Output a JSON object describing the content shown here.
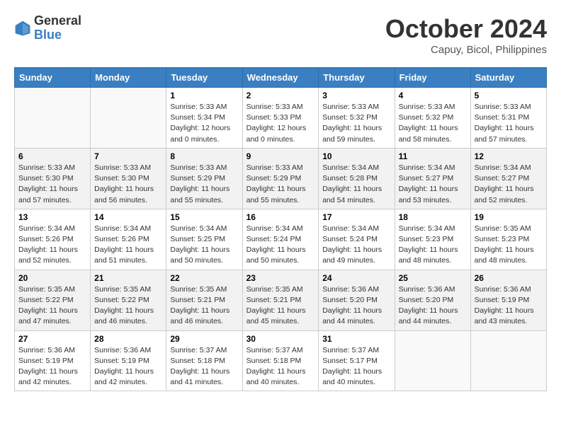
{
  "header": {
    "logo_line1": "General",
    "logo_line2": "Blue",
    "month": "October 2024",
    "location": "Capuy, Bicol, Philippines"
  },
  "days_of_week": [
    "Sunday",
    "Monday",
    "Tuesday",
    "Wednesday",
    "Thursday",
    "Friday",
    "Saturday"
  ],
  "weeks": [
    [
      {
        "day": "",
        "sunrise": "",
        "sunset": "",
        "daylight": ""
      },
      {
        "day": "",
        "sunrise": "",
        "sunset": "",
        "daylight": ""
      },
      {
        "day": "1",
        "sunrise": "Sunrise: 5:33 AM",
        "sunset": "Sunset: 5:34 PM",
        "daylight": "Daylight: 12 hours and 0 minutes."
      },
      {
        "day": "2",
        "sunrise": "Sunrise: 5:33 AM",
        "sunset": "Sunset: 5:33 PM",
        "daylight": "Daylight: 12 hours and 0 minutes."
      },
      {
        "day": "3",
        "sunrise": "Sunrise: 5:33 AM",
        "sunset": "Sunset: 5:32 PM",
        "daylight": "Daylight: 11 hours and 59 minutes."
      },
      {
        "day": "4",
        "sunrise": "Sunrise: 5:33 AM",
        "sunset": "Sunset: 5:32 PM",
        "daylight": "Daylight: 11 hours and 58 minutes."
      },
      {
        "day": "5",
        "sunrise": "Sunrise: 5:33 AM",
        "sunset": "Sunset: 5:31 PM",
        "daylight": "Daylight: 11 hours and 57 minutes."
      }
    ],
    [
      {
        "day": "6",
        "sunrise": "Sunrise: 5:33 AM",
        "sunset": "Sunset: 5:30 PM",
        "daylight": "Daylight: 11 hours and 57 minutes."
      },
      {
        "day": "7",
        "sunrise": "Sunrise: 5:33 AM",
        "sunset": "Sunset: 5:30 PM",
        "daylight": "Daylight: 11 hours and 56 minutes."
      },
      {
        "day": "8",
        "sunrise": "Sunrise: 5:33 AM",
        "sunset": "Sunset: 5:29 PM",
        "daylight": "Daylight: 11 hours and 55 minutes."
      },
      {
        "day": "9",
        "sunrise": "Sunrise: 5:33 AM",
        "sunset": "Sunset: 5:29 PM",
        "daylight": "Daylight: 11 hours and 55 minutes."
      },
      {
        "day": "10",
        "sunrise": "Sunrise: 5:34 AM",
        "sunset": "Sunset: 5:28 PM",
        "daylight": "Daylight: 11 hours and 54 minutes."
      },
      {
        "day": "11",
        "sunrise": "Sunrise: 5:34 AM",
        "sunset": "Sunset: 5:27 PM",
        "daylight": "Daylight: 11 hours and 53 minutes."
      },
      {
        "day": "12",
        "sunrise": "Sunrise: 5:34 AM",
        "sunset": "Sunset: 5:27 PM",
        "daylight": "Daylight: 11 hours and 52 minutes."
      }
    ],
    [
      {
        "day": "13",
        "sunrise": "Sunrise: 5:34 AM",
        "sunset": "Sunset: 5:26 PM",
        "daylight": "Daylight: 11 hours and 52 minutes."
      },
      {
        "day": "14",
        "sunrise": "Sunrise: 5:34 AM",
        "sunset": "Sunset: 5:26 PM",
        "daylight": "Daylight: 11 hours and 51 minutes."
      },
      {
        "day": "15",
        "sunrise": "Sunrise: 5:34 AM",
        "sunset": "Sunset: 5:25 PM",
        "daylight": "Daylight: 11 hours and 50 minutes."
      },
      {
        "day": "16",
        "sunrise": "Sunrise: 5:34 AM",
        "sunset": "Sunset: 5:24 PM",
        "daylight": "Daylight: 11 hours and 50 minutes."
      },
      {
        "day": "17",
        "sunrise": "Sunrise: 5:34 AM",
        "sunset": "Sunset: 5:24 PM",
        "daylight": "Daylight: 11 hours and 49 minutes."
      },
      {
        "day": "18",
        "sunrise": "Sunrise: 5:34 AM",
        "sunset": "Sunset: 5:23 PM",
        "daylight": "Daylight: 11 hours and 48 minutes."
      },
      {
        "day": "19",
        "sunrise": "Sunrise: 5:35 AM",
        "sunset": "Sunset: 5:23 PM",
        "daylight": "Daylight: 11 hours and 48 minutes."
      }
    ],
    [
      {
        "day": "20",
        "sunrise": "Sunrise: 5:35 AM",
        "sunset": "Sunset: 5:22 PM",
        "daylight": "Daylight: 11 hours and 47 minutes."
      },
      {
        "day": "21",
        "sunrise": "Sunrise: 5:35 AM",
        "sunset": "Sunset: 5:22 PM",
        "daylight": "Daylight: 11 hours and 46 minutes."
      },
      {
        "day": "22",
        "sunrise": "Sunrise: 5:35 AM",
        "sunset": "Sunset: 5:21 PM",
        "daylight": "Daylight: 11 hours and 46 minutes."
      },
      {
        "day": "23",
        "sunrise": "Sunrise: 5:35 AM",
        "sunset": "Sunset: 5:21 PM",
        "daylight": "Daylight: 11 hours and 45 minutes."
      },
      {
        "day": "24",
        "sunrise": "Sunrise: 5:36 AM",
        "sunset": "Sunset: 5:20 PM",
        "daylight": "Daylight: 11 hours and 44 minutes."
      },
      {
        "day": "25",
        "sunrise": "Sunrise: 5:36 AM",
        "sunset": "Sunset: 5:20 PM",
        "daylight": "Daylight: 11 hours and 44 minutes."
      },
      {
        "day": "26",
        "sunrise": "Sunrise: 5:36 AM",
        "sunset": "Sunset: 5:19 PM",
        "daylight": "Daylight: 11 hours and 43 minutes."
      }
    ],
    [
      {
        "day": "27",
        "sunrise": "Sunrise: 5:36 AM",
        "sunset": "Sunset: 5:19 PM",
        "daylight": "Daylight: 11 hours and 42 minutes."
      },
      {
        "day": "28",
        "sunrise": "Sunrise: 5:36 AM",
        "sunset": "Sunset: 5:19 PM",
        "daylight": "Daylight: 11 hours and 42 minutes."
      },
      {
        "day": "29",
        "sunrise": "Sunrise: 5:37 AM",
        "sunset": "Sunset: 5:18 PM",
        "daylight": "Daylight: 11 hours and 41 minutes."
      },
      {
        "day": "30",
        "sunrise": "Sunrise: 5:37 AM",
        "sunset": "Sunset: 5:18 PM",
        "daylight": "Daylight: 11 hours and 40 minutes."
      },
      {
        "day": "31",
        "sunrise": "Sunrise: 5:37 AM",
        "sunset": "Sunset: 5:17 PM",
        "daylight": "Daylight: 11 hours and 40 minutes."
      },
      {
        "day": "",
        "sunrise": "",
        "sunset": "",
        "daylight": ""
      },
      {
        "day": "",
        "sunrise": "",
        "sunset": "",
        "daylight": ""
      }
    ]
  ]
}
